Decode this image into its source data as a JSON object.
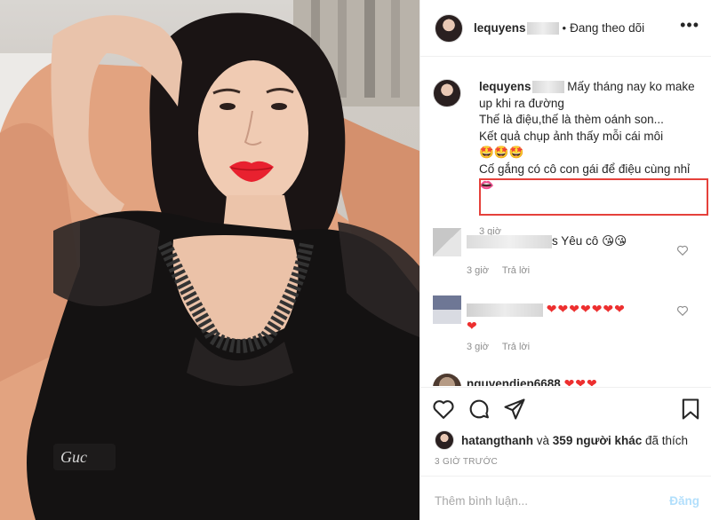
{
  "header": {
    "username": "lequyens",
    "separator": "•",
    "follow_status": "Đang theo dõi",
    "more_icon": "more-horizontal-icon"
  },
  "caption": {
    "username": "lequyens",
    "line1": "Mấy tháng nay ko make up khi ra đường",
    "line2": "Thế là điệu,thế là thèm oánh son...",
    "line3": "Kết quả chụp ảnh thấy mỗi cái môi",
    "line3_emoji": "🤩🤩🤩",
    "highlight_text": "Cố gắng có cô con gái để điệu cùng nhỉ",
    "highlight_emoji": "👄",
    "time": "3 giờ"
  },
  "comments": [
    {
      "suffix": "s Yêu cô",
      "emoji": "😘😘",
      "time": "3 giờ",
      "reply": "Trả lời"
    },
    {
      "hearts": "❤❤❤❤❤❤❤",
      "hearts2": "❤",
      "time": "3 giờ",
      "reply": "Trả lời"
    },
    {
      "username": "nguyendiep6688",
      "hearts": "❤❤❤"
    }
  ],
  "actions": {
    "like_icon": "heart-icon",
    "comment_icon": "comment-icon",
    "share_icon": "send-icon",
    "save_icon": "bookmark-icon"
  },
  "likes": {
    "user": "hatangthanh",
    "connector": "và",
    "others": "359 người khác",
    "suffix": "đã thích"
  },
  "time_ago": "3 GIỜ TRƯỚC",
  "add_comment": {
    "placeholder": "Thêm bình luận...",
    "post_label": "Đăng"
  },
  "colors": {
    "highlight_border": "#e5413b",
    "post_disabled": "#b2dffc",
    "muted": "#8e8e8e",
    "heart": "#ed2f2f"
  }
}
